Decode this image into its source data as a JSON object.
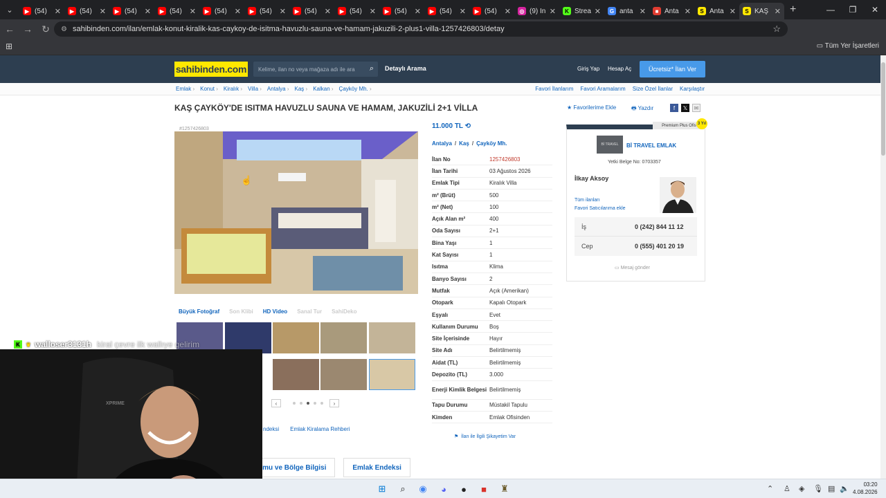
{
  "browser": {
    "tabs": [
      {
        "title": "(54) ",
        "color": "#ff0000",
        "glyph": "▶"
      },
      {
        "title": "(54) ",
        "color": "#ff0000",
        "glyph": "▶"
      },
      {
        "title": "(54) ",
        "color": "#ff0000",
        "glyph": "▶"
      },
      {
        "title": "(54) ",
        "color": "#ff0000",
        "glyph": "▶"
      },
      {
        "title": "(54) ",
        "color": "#ff0000",
        "glyph": "▶"
      },
      {
        "title": "(54) ",
        "color": "#ff0000",
        "glyph": "▶"
      },
      {
        "title": "(54) ",
        "color": "#ff0000",
        "glyph": "▶"
      },
      {
        "title": "(54) ",
        "color": "#ff0000",
        "glyph": "▶"
      },
      {
        "title": "(54) ",
        "color": "#ff0000",
        "glyph": "▶"
      },
      {
        "title": "(54) ",
        "color": "#ff0000",
        "glyph": "▶"
      },
      {
        "title": "(54) ",
        "color": "#ff0000",
        "glyph": "▶"
      },
      {
        "title": "(9) In",
        "color": "#d6249f",
        "glyph": "◎"
      },
      {
        "title": "Strea",
        "color": "#53fc18",
        "glyph": "K"
      },
      {
        "title": "anta",
        "color": "#4285f4",
        "glyph": "G"
      },
      {
        "title": "Anta",
        "color": "#e03c31",
        "glyph": "■"
      },
      {
        "title": "Anta",
        "color": "#ffe800",
        "glyph": "S"
      },
      {
        "title": "KAŞ",
        "color": "#ffe800",
        "glyph": "S",
        "active": true
      }
    ],
    "url": "sahibinden.com/ilan/emlak-konut-kiralik-kas-caykoy-de-isitma-havuzlu-sauna-ve-hamam-jakuzili-2-plus1-villa-1257426803/detay",
    "bookmarks_all": "Tüm Yer İşaretleri",
    "profile_initial": "U"
  },
  "site": {
    "logo": "sahibinden.com",
    "search_placeholder": "Kelime, ilan no veya mağaza adı ile ara",
    "detailed_search": "Detaylı Arama",
    "login": "Giriş Yap",
    "register": "Hesap Aç",
    "post_ad": "Ücretsiz* İlan Ver",
    "breadcrumbs": [
      "Emlak",
      "Konut",
      "Kiralık",
      "Villa",
      "Antalya",
      "Kaş",
      "Kalkan",
      "Çayköy Mh."
    ],
    "top_links": [
      "Favori İlanlarım",
      "Favori Aramalarım",
      "Size Özel İlanlar",
      "Karşılaştır"
    ]
  },
  "listing": {
    "title": "KAŞ ÇAYKÖY'DE ISITMA HAVUZLU SAUNA VE HAMAM, JAKUZİLİ 2+1 VİLLA",
    "add_favorite": "★ Favorilerime Ekle",
    "print": "Yazdır",
    "id_label": "#1257426803",
    "price": "11.000 TL",
    "location": [
      "Antalya",
      "Kaş",
      "Çayköy Mh."
    ],
    "photo_actions": [
      "Büyük Fotoğraf",
      "Son Klibi",
      "HD Video",
      "Sanal Tur",
      "SahiDeko"
    ],
    "details": [
      {
        "k": "İlan No",
        "v": "1257426803",
        "red": true
      },
      {
        "k": "İlan Tarihi",
        "v": "03 Ağustos 2026"
      },
      {
        "k": "Emlak Tipi",
        "v": "Kiralık Villa"
      },
      {
        "k": "m² (Brüt)",
        "v": "500"
      },
      {
        "k": "m² (Net)",
        "v": "100"
      },
      {
        "k": "Açık Alan m²",
        "v": "400"
      },
      {
        "k": "Oda Sayısı",
        "v": "2+1"
      },
      {
        "k": "Bina Yaşı",
        "v": "1"
      },
      {
        "k": "Kat Sayısı",
        "v": "1"
      },
      {
        "k": "Isıtma",
        "v": "Klima"
      },
      {
        "k": "Banyo Sayısı",
        "v": "2"
      },
      {
        "k": "Mutfak",
        "v": "Açık (Amerikan)"
      },
      {
        "k": "Otopark",
        "v": "Kapalı Otopark"
      },
      {
        "k": "Eşyalı",
        "v": "Evet"
      },
      {
        "k": "Kullanım Durumu",
        "v": "Boş"
      },
      {
        "k": "Site İçerisinde",
        "v": "Hayır"
      },
      {
        "k": "Site Adı",
        "v": "Belirtilmemiş"
      },
      {
        "k": "Aidat (TL)",
        "v": "Belirtilmemiş"
      },
      {
        "k": "Depozito (TL)",
        "v": "3.000"
      },
      {
        "k": "Enerji Kimlik Belgesi",
        "v": "Belirtilmemiş",
        "tall": true
      },
      {
        "k": "Tapu Durumu",
        "v": "Müstakil Tapulu"
      },
      {
        "k": "Kimden",
        "v": "Emlak Ofisinden"
      }
    ],
    "complaint": "İlan ile İlgili Şikayetim Var",
    "link_row": [
      "ndeksi",
      "Emlak Kiralama Rehberi"
    ],
    "bottom_tabs": [
      "umu ve Bölge Bilgisi",
      "Emlak Endeksi"
    ]
  },
  "seller": {
    "premium_label": "Premium Plus Ofis",
    "badge_years": "3 Yıl",
    "agency_logo_text": "Bİ TRAVEL",
    "agency": "Bİ TRAVEL EMLAK",
    "licence": "Yetki Belge No: 0703357",
    "agent": "İlkay Aksoy",
    "all_listings": "Tüm ilanları",
    "fav_seller": "Favori Satıcılarıma ekle",
    "phones": [
      {
        "k": "İş",
        "v": "0 (242) 844 11 12"
      },
      {
        "k": "Cep",
        "v": "0 (555) 401 20 19"
      }
    ],
    "message": "Mesaj gönder"
  },
  "overlay": {
    "chat_user": "walloser3131h",
    "chat_message": "kiral çevre ilk wallıye gelirim",
    "webcam_brand": "XPRIME"
  },
  "taskbar": {
    "time": "03:20",
    "date": "4.08.2026"
  }
}
